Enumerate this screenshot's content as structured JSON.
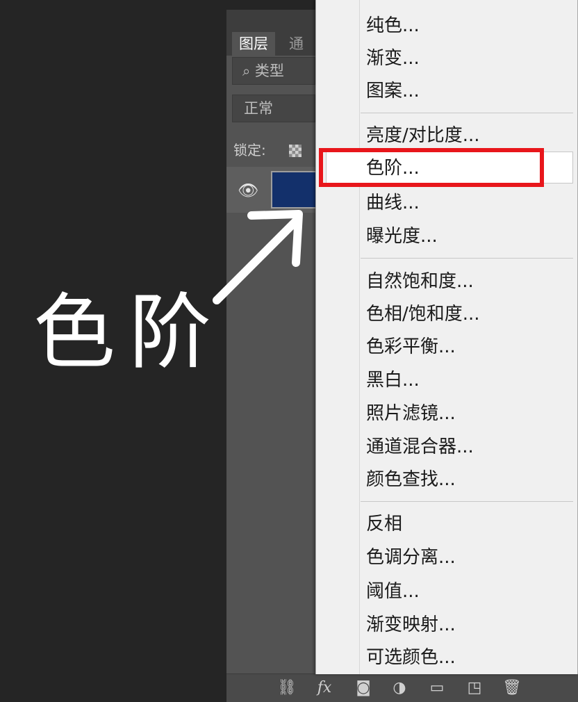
{
  "panel": {
    "tabs": [
      "图层",
      "通道"
    ],
    "filter_placeholder": "类型",
    "blend_mode": "正常",
    "lock_label": "锁定:"
  },
  "menu": {
    "group1": [
      "纯色...",
      "渐变...",
      "图案..."
    ],
    "group2": [
      "亮度/对比度...",
      "色阶...",
      "曲线...",
      "曝光度..."
    ],
    "group3": [
      "自然饱和度...",
      "色相/饱和度...",
      "色彩平衡...",
      "黑白...",
      "照片滤镜...",
      "通道混合器...",
      "颜色查找..."
    ],
    "group4": [
      "反相",
      "色调分离...",
      "阈值...",
      "渐变映射...",
      "可选颜色..."
    ],
    "highlighted_item": "色阶..."
  },
  "annotation": {
    "label": "色阶",
    "highlight_color": "#e8161b"
  },
  "bottom_bar_icons": [
    "link-icon",
    "fx-icon",
    "mask-icon",
    "adjustment-icon",
    "folder-icon",
    "new-layer-icon",
    "trash-icon"
  ]
}
